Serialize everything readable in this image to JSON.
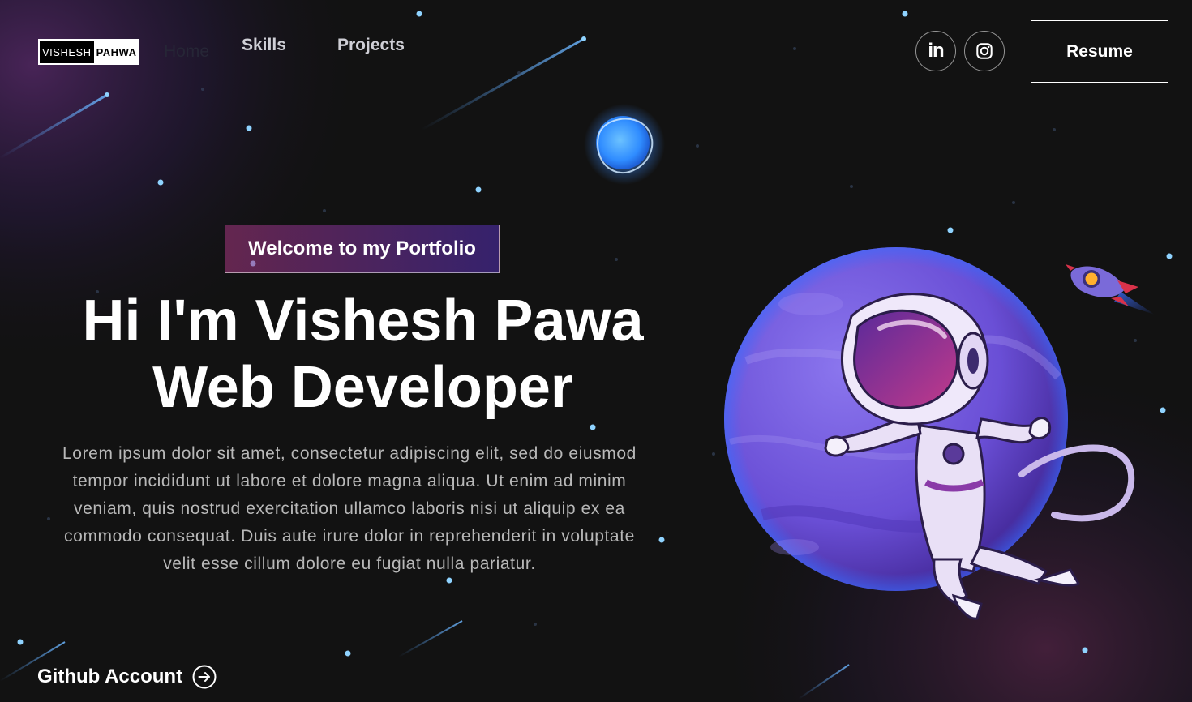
{
  "brand": {
    "first": "VISHESH",
    "last": "PAHWA"
  },
  "nav": {
    "home": "Home",
    "skills": "Skills",
    "projects": "Projects"
  },
  "social": {
    "linkedin_label": "in",
    "linkedin_icon": "linkedin-icon",
    "instagram_icon": "instagram-icon"
  },
  "resume_label": "Resume",
  "hero": {
    "tagline": "Welcome to my Portfolio",
    "headline_line1": "Hi I'm Vishesh Pawa",
    "headline_line2": "Web Developer",
    "intro": "Lorem ipsum dolor sit amet, consectetur adipiscing elit, sed do eiusmod tempor incididunt ut labore et dolore magna aliqua. Ut enim ad minim veniam, quis nostrud exercitation ullamco laboris nisi ut aliquip ex ea commodo consequat. Duis aute irure dolor in reprehenderit in voluptate velit esse cillum dolore eu fugiat nulla pariatur.",
    "github_label": "Github Account",
    "github_icon": "arrow-right-circle-icon"
  },
  "illustration": {
    "astronaut_icon": "astronaut-icon",
    "planet_icon": "purple-planet-icon",
    "small_planet_icon": "blue-planet-icon",
    "rocket_icon": "rocket-icon"
  },
  "colors": {
    "background": "#121212",
    "accent_pink": "#aa367c",
    "accent_purple": "#4a2fbd",
    "planet": "#6b4fd8",
    "star": "#8fd3ff"
  }
}
